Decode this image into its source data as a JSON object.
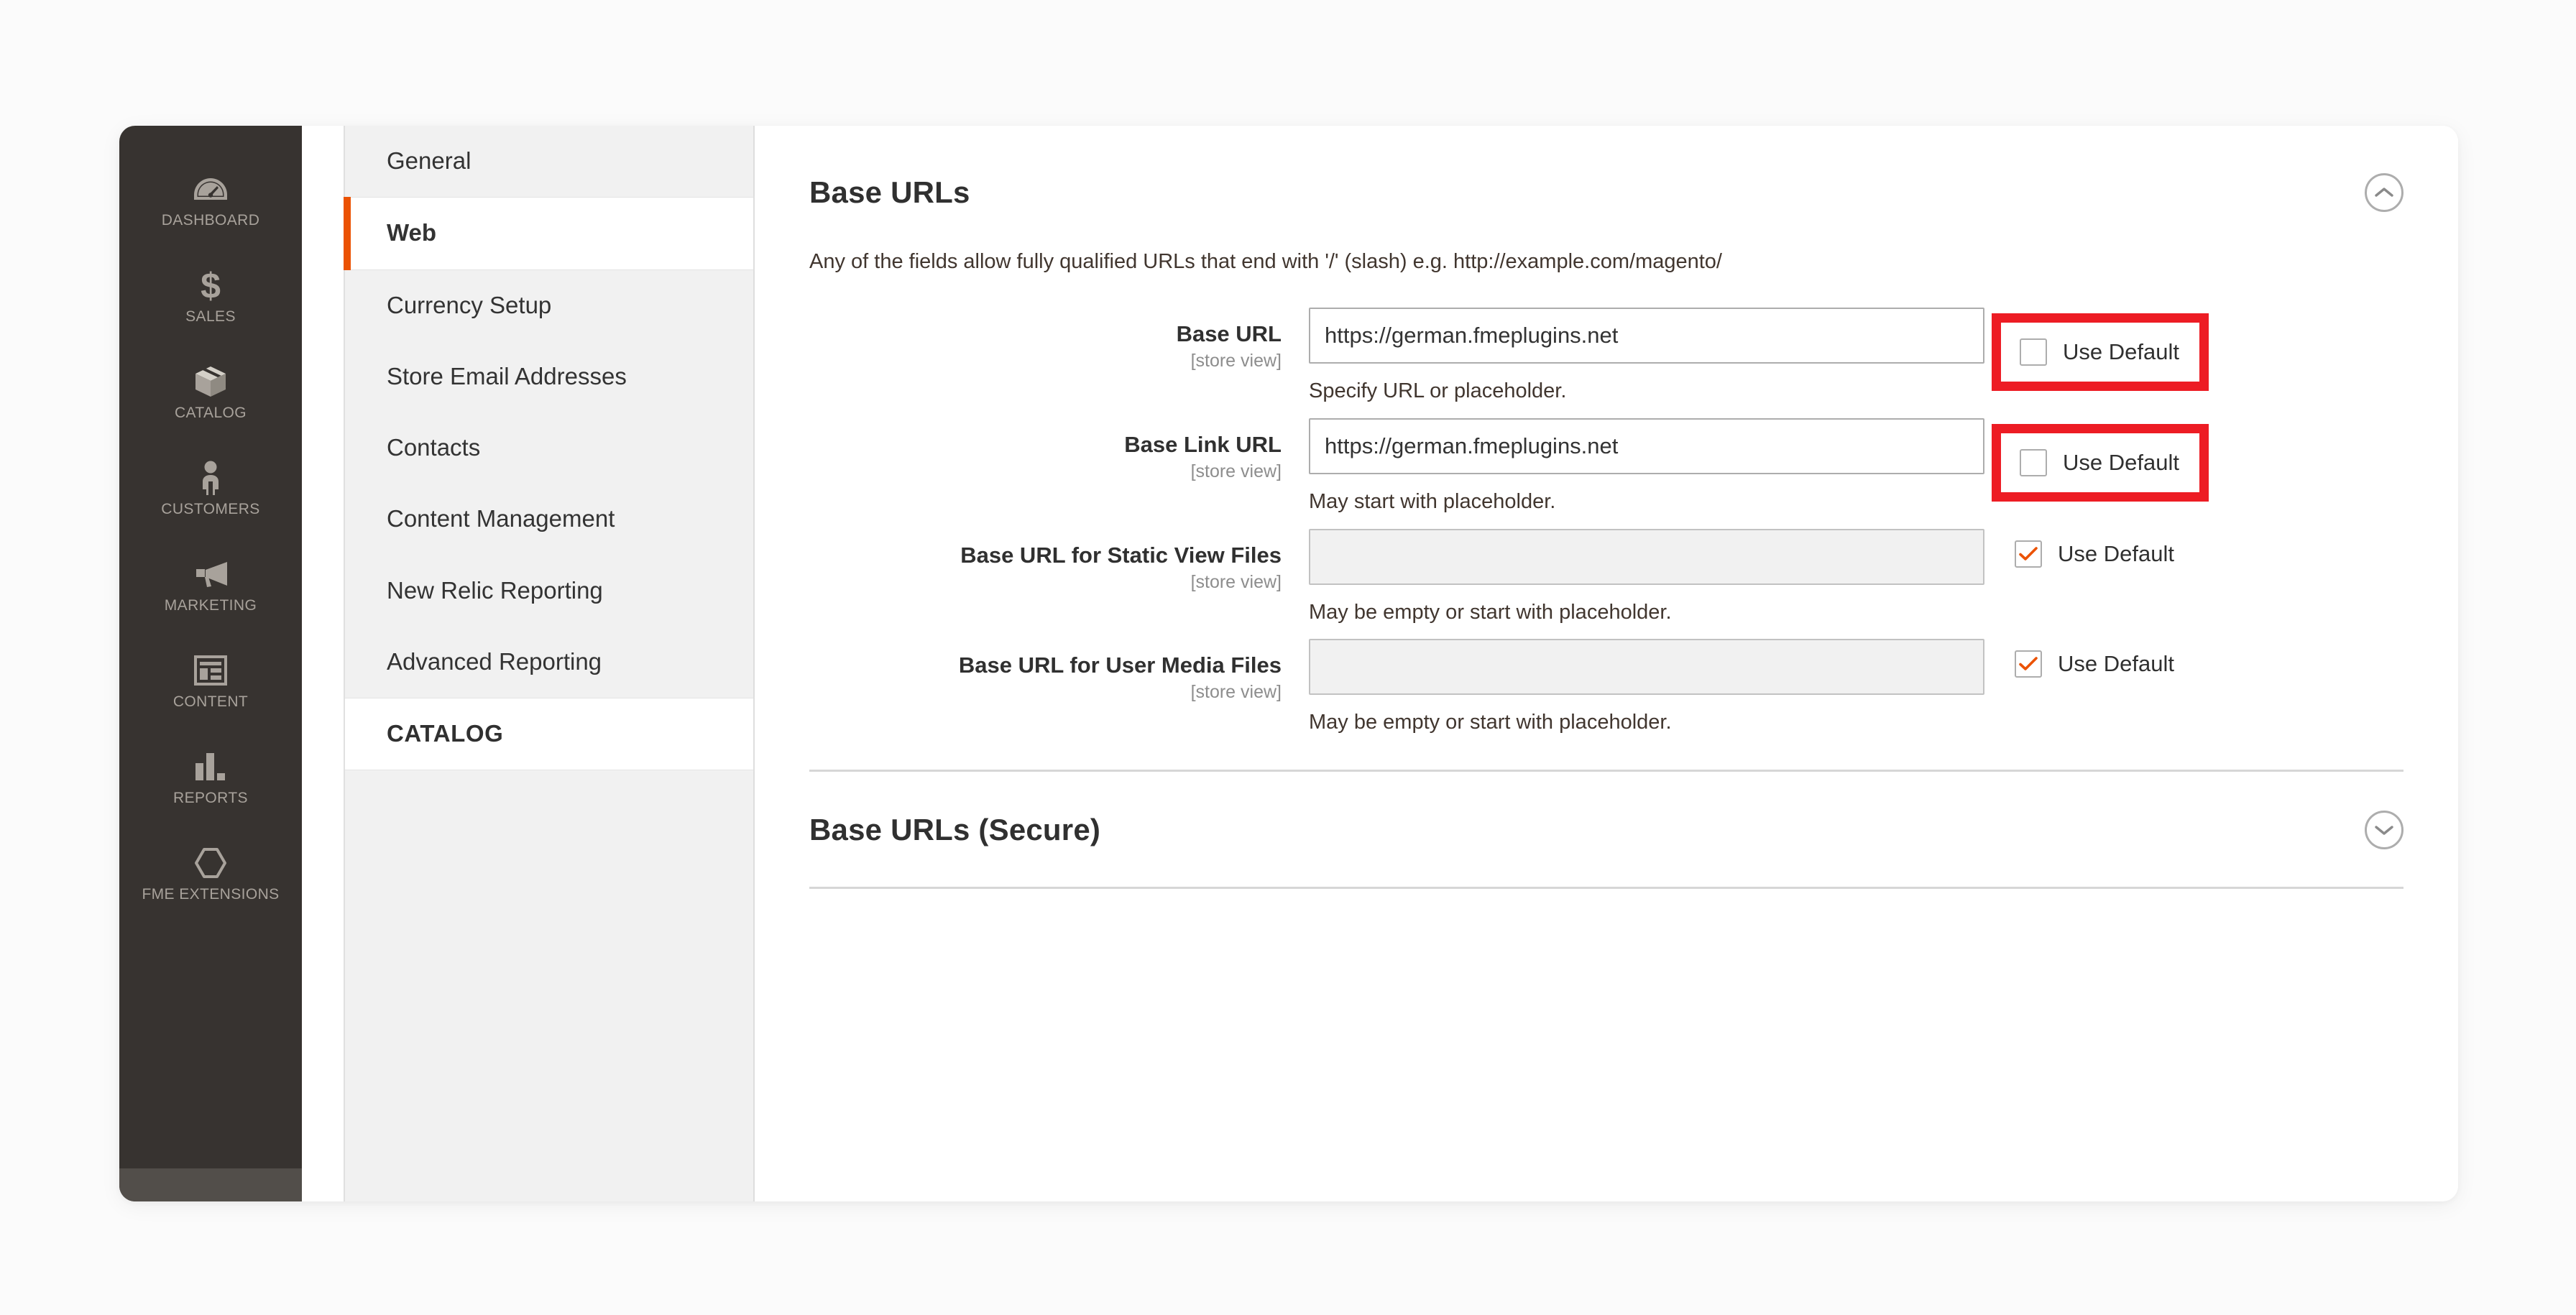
{
  "colors": {
    "accent": "#eb5202",
    "highlight": "#ed1c24",
    "sidebar_bg": "#373330",
    "sidebar_text": "#a8a29b",
    "panel_bg": "#f1f1f1"
  },
  "primary_nav": {
    "items": [
      {
        "label": "DASHBOARD",
        "icon": "gauge-icon"
      },
      {
        "label": "SALES",
        "icon": "dollar-icon"
      },
      {
        "label": "CATALOG",
        "icon": "box-icon"
      },
      {
        "label": "CUSTOMERS",
        "icon": "person-icon"
      },
      {
        "label": "MARKETING",
        "icon": "megaphone-icon"
      },
      {
        "label": "CONTENT",
        "icon": "layout-icon"
      },
      {
        "label": "REPORTS",
        "icon": "bar-chart-icon"
      },
      {
        "label": "FME EXTENSIONS",
        "icon": "hexagon-icon"
      }
    ]
  },
  "section_nav": {
    "items": [
      {
        "label": "General",
        "state": "normal"
      },
      {
        "label": "Web",
        "state": "active"
      },
      {
        "label": "Currency Setup",
        "state": "normal"
      },
      {
        "label": "Store Email Addresses",
        "state": "normal"
      },
      {
        "label": "Contacts",
        "state": "normal"
      },
      {
        "label": "Content Management",
        "state": "normal"
      },
      {
        "label": "New Relic Reporting",
        "state": "normal"
      },
      {
        "label": "Advanced Reporting",
        "state": "normal"
      },
      {
        "label": "CATALOG",
        "state": "group"
      }
    ]
  },
  "main": {
    "base_urls": {
      "title": "Base URLs",
      "collapse_icon": "chevron-up-icon",
      "description": "Any of the fields allow fully qualified URLs that end with '/' (slash) e.g. http://example.com/magento/",
      "rows": [
        {
          "label": "Base URL",
          "scope": "[store view]",
          "value": "https://german.fmeplugins.net",
          "placeholder": "",
          "note": "Specify URL or placeholder.",
          "disabled": false,
          "use_default": {
            "label": "Use Default",
            "checked": false,
            "highlighted": true
          }
        },
        {
          "label": "Base Link URL",
          "scope": "[store view]",
          "value": "https://german.fmeplugins.net",
          "placeholder": "",
          "note": "May start with placeholder.",
          "disabled": false,
          "use_default": {
            "label": "Use Default",
            "checked": false,
            "highlighted": true
          }
        },
        {
          "label": "Base URL for Static View Files",
          "scope": "[store view]",
          "value": "",
          "placeholder": "",
          "note": "May be empty or start with placeholder.",
          "disabled": true,
          "use_default": {
            "label": "Use Default",
            "checked": true,
            "highlighted": false
          }
        },
        {
          "label": "Base URL for User Media Files",
          "scope": "[store view]",
          "value": "",
          "placeholder": "",
          "note": "May be empty or start with placeholder.",
          "disabled": true,
          "use_default": {
            "label": "Use Default",
            "checked": true,
            "highlighted": false
          }
        }
      ]
    },
    "base_urls_secure": {
      "title": "Base URLs (Secure)",
      "collapse_icon": "chevron-down-icon"
    }
  }
}
